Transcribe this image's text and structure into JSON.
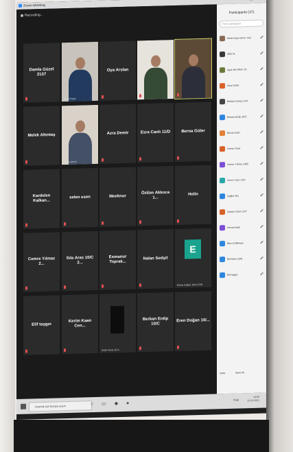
{
  "window": {
    "title": "Zoom Meeting"
  },
  "meeting": {
    "recording_label": "Recording..."
  },
  "tiles": [
    {
      "name": "Damla Güzel 2137",
      "label": ""
    },
    {
      "name": "",
      "label": "Metin Kaya"
    },
    {
      "name": "Oya Arslan",
      "label": ""
    },
    {
      "name": "",
      "label": ""
    },
    {
      "name": "",
      "label": ""
    },
    {
      "name": "Melek Altıntaş",
      "label": ""
    },
    {
      "name": "",
      "label": "Selim yavuz"
    },
    {
      "name": "Azra Demir",
      "label": ""
    },
    {
      "name": "Esra Canlı 11/D",
      "label": ""
    },
    {
      "name": "Berna Güler",
      "label": ""
    },
    {
      "name": "Kardelen  Kalkan...",
      "label": ""
    },
    {
      "name": "selen esen",
      "label": ""
    },
    {
      "name": "Meeknur",
      "label": ""
    },
    {
      "name": "Özlüm Akkoca 1...",
      "label": ""
    },
    {
      "name": "Helin",
      "label": ""
    },
    {
      "name": "Cemre Yılmaz 2...",
      "label": ""
    },
    {
      "name": "Sıla Aras 10/C 2...",
      "label": ""
    },
    {
      "name": "Esmanur Toprak...",
      "label": ""
    },
    {
      "name": "Nalan Sedşit",
      "label": ""
    },
    {
      "name": "",
      "label": "Esma Doğan 10/A 2138"
    },
    {
      "name": "Elif taşgın",
      "label": ""
    },
    {
      "name": "Kerim Kaan Cen...",
      "label": ""
    },
    {
      "name": "",
      "label": "Sude Ferat 10-A"
    },
    {
      "name": "Berkan Erdip 10/C",
      "label": ""
    },
    {
      "name": "Eren Doğan 10/...",
      "label": ""
    }
  ],
  "participants_panel": {
    "title": "Participants (37)",
    "search_placeholder": "Find a participant",
    "items": [
      {
        "name": "Metin Kaya (Host, me)",
        "color": "#8a6a55"
      },
      {
        "name": "SBS Te",
        "color": "#3a3a3a"
      },
      {
        "name": "Ayşe Nur Bilen 10...",
        "color": "#6b7a3a"
      },
      {
        "name": "Azra Demir",
        "color": "#d9622b"
      },
      {
        "name": "Berkan Güneş 11/A",
        "color": "#444"
      },
      {
        "name": "Berkan Erdip 10/C",
        "color": "#2e86de"
      },
      {
        "name": "Berna Güler",
        "color": "#e0803a"
      },
      {
        "name": "Cemre Tutar",
        "color": "#d9622b"
      },
      {
        "name": "Cemre Yılmaz 2465",
        "color": "#7b4fd6"
      },
      {
        "name": "Ceren Yüce 11/D",
        "color": "#2aa6a6"
      },
      {
        "name": "Çağlar Akç",
        "color": "#2e86de"
      },
      {
        "name": "Damla Güzel 2137",
        "color": "#d9622b"
      },
      {
        "name": "Derma Aşan",
        "color": "#7b4fd6"
      },
      {
        "name": "Ebru Çelikkaya",
        "color": "#2e86de"
      },
      {
        "name": "Elif Kalın 10/B",
        "color": "#2e86de"
      },
      {
        "name": "Elif taşgın",
        "color": "#2e86de"
      }
    ],
    "footer": {
      "invite": "Invite",
      "mute_all": "Mute All"
    }
  },
  "taskbar": {
    "search_placeholder": "Aramak için buraya yazın",
    "lang": "TUR",
    "time": "13:05",
    "date": "21.01.2021"
  }
}
